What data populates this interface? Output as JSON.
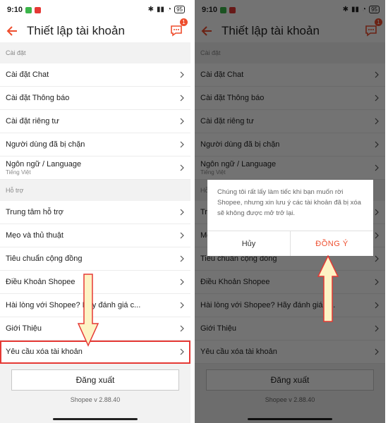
{
  "status": {
    "time": "9:10",
    "battery": "95"
  },
  "appbar": {
    "title": "Thiết lập tài khoản",
    "badge": "1"
  },
  "sections": {
    "settings": "Cài đặt",
    "support": "Hỗ trợ"
  },
  "settings_items": [
    {
      "label": "Cài đặt Chat"
    },
    {
      "label": "Cài đặt Thông báo"
    },
    {
      "label": "Cài đặt riêng tư"
    },
    {
      "label": "Người dùng đã bị chặn"
    },
    {
      "label": "Ngôn ngữ / Language",
      "sub": "Tiếng Việt"
    }
  ],
  "support_items": [
    {
      "label": "Trung tâm hỗ trợ"
    },
    {
      "label": "Mẹo và thủ thuật"
    },
    {
      "label": "Tiêu chuẩn cộng đồng"
    },
    {
      "label": "Điều Khoản Shopee"
    },
    {
      "label": "Hài lòng với Shopee? Hãy đánh giá c..."
    },
    {
      "label": "Giới Thiệu"
    },
    {
      "label": "Yêu cầu xóa tài khoản"
    }
  ],
  "logout_label": "Đăng xuất",
  "version": "Shopee v 2.88.40",
  "dialog": {
    "message": "Chúng tôi rất lấy làm tiếc khi bạn muốn rời Shopee, nhưng xin lưu ý các tài khoản đã bị xóa sẽ không được mở trở lại.",
    "cancel": "Hủy",
    "confirm": "ĐỒNG Ý"
  },
  "colors": {
    "accent": "#ee4d2d",
    "highlight": "#e53935",
    "arrow_fill": "#fdf3c4"
  }
}
